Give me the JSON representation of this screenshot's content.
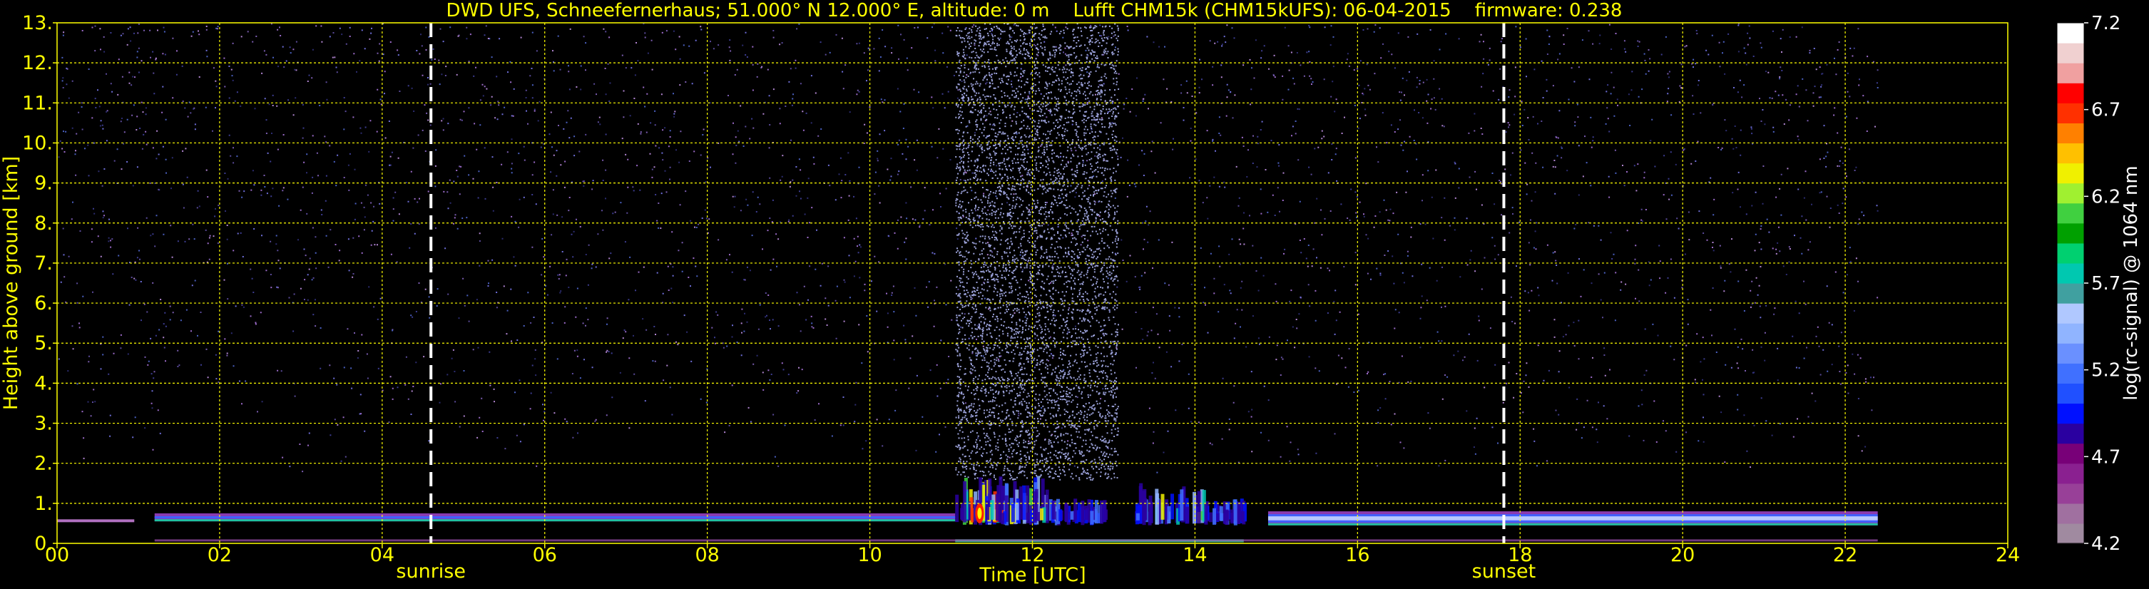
{
  "chart_data": {
    "type": "heatmap",
    "title": "DWD UFS, Schneefernerhaus; 51.000° N 12.000° E, altitude: 0 m    Lufft CHM15k (CHM15kUFS): 06-04-2015    firmware: 0.238",
    "xlabel": "Time [UTC]",
    "ylabel": "Height above ground [km]",
    "xlim": [
      0,
      24
    ],
    "ylim": [
      0,
      13
    ],
    "x_ticks": [
      0,
      2,
      4,
      6,
      8,
      10,
      12,
      14,
      16,
      18,
      20,
      22,
      24
    ],
    "x_tick_labels": [
      "00",
      "02",
      "04",
      "06",
      "08",
      "10",
      "12",
      "14",
      "16",
      "18",
      "20",
      "22",
      "24"
    ],
    "y_ticks": [
      0,
      1,
      2,
      3,
      4,
      5,
      6,
      7,
      8,
      9,
      10,
      11,
      12,
      13
    ],
    "y_tick_labels": [
      "0.",
      "1.",
      "2.",
      "3.",
      "4.",
      "5.",
      "6.",
      "7.",
      "8.",
      "9.",
      "10.",
      "11.",
      "12.",
      "13."
    ],
    "grid": true,
    "data_end_time": 22.4,
    "markers": [
      {
        "label": "sunrise",
        "time": 4.6
      },
      {
        "label": "sunset",
        "time": 17.8
      }
    ],
    "layers": [
      {
        "kind": "boundary-layer",
        "t_start": 1.2,
        "t_end": 11.05,
        "base_km": 0.55,
        "top_km": 0.75
      },
      {
        "kind": "convective-plumes",
        "t_start": 11.05,
        "t_end": 14.6,
        "base_km": 0.45,
        "top_km": 1.7
      },
      {
        "kind": "boundary-layer",
        "t_start": 14.9,
        "t_end": 22.4,
        "base_km": 0.45,
        "top_km": 0.8
      }
    ],
    "colorbar": {
      "label": "log(rc-signal) @ 1064 nm",
      "min": 4.2,
      "max": 7.2,
      "ticks": [
        4.2,
        4.7,
        5.2,
        5.7,
        6.2,
        6.7,
        7.2
      ],
      "tick_labels": [
        "4.2",
        "4.7",
        "5.2",
        "5.7",
        "6.2",
        "6.7",
        "7.2"
      ],
      "colors": [
        "#a08aa0",
        "#a070a0",
        "#984098",
        "#8a2090",
        "#780078",
        "#2a00a0",
        "#0010ff",
        "#2050ff",
        "#4070ff",
        "#6a90ff",
        "#90b4ff",
        "#b0c8ff",
        "#40a0a0",
        "#00c8b0",
        "#00d070",
        "#00a000",
        "#40d040",
        "#a0f030",
        "#f0f000",
        "#ffc000",
        "#ff8000",
        "#ff3000",
        "#ff0000",
        "#f0a0a0",
        "#f0d0d0",
        "#ffffff"
      ]
    }
  }
}
